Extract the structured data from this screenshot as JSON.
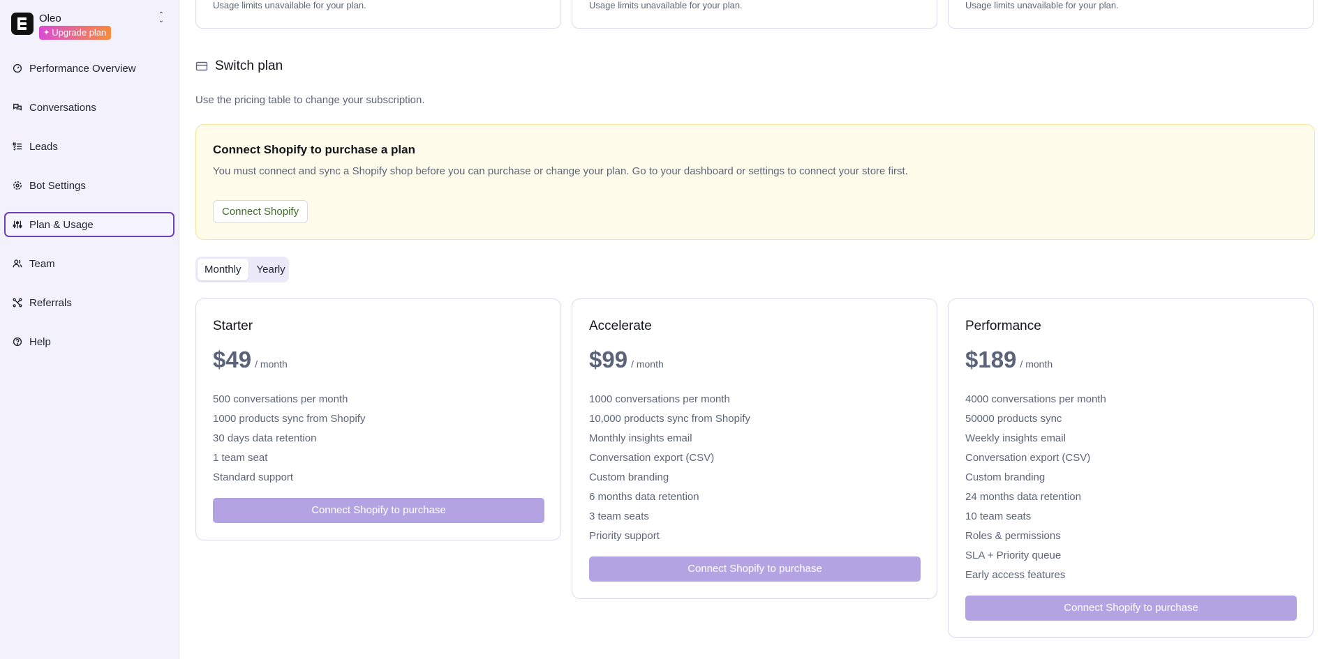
{
  "sidebar": {
    "workspace_name": "Oleo",
    "upgrade_label": "Upgrade plan",
    "items": [
      {
        "label": "Performance Overview",
        "icon": "gauge-icon"
      },
      {
        "label": "Conversations",
        "icon": "chat-icon"
      },
      {
        "label": "Leads",
        "icon": "list-check-icon"
      },
      {
        "label": "Bot Settings",
        "icon": "gear-icon"
      },
      {
        "label": "Plan & Usage",
        "icon": "sliders-icon",
        "active": true
      },
      {
        "label": "Team",
        "icon": "users-icon"
      },
      {
        "label": "Referrals",
        "icon": "network-icon"
      },
      {
        "label": "Help",
        "icon": "help-circle-icon"
      }
    ]
  },
  "usage": {
    "cards": [
      {
        "text": "Usage limits unavailable for your plan."
      },
      {
        "text": "Usage limits unavailable for your plan."
      },
      {
        "text": "Usage limits unavailable for your plan."
      }
    ]
  },
  "switch_plan": {
    "title": "Switch plan",
    "subtitle": "Use the pricing table to change your subscription.",
    "icon": "credit-card-icon"
  },
  "alert": {
    "title": "Connect Shopify to purchase a plan",
    "text": "You must connect and sync a Shopify shop before you can purchase or change your plan. Go to your dashboard or settings to connect your store first.",
    "button_label": "Connect Shopify"
  },
  "billing_toggle": {
    "options": [
      "Monthly",
      "Yearly"
    ],
    "selected": "Monthly"
  },
  "plans": [
    {
      "name": "Starter",
      "price": "$49",
      "unit": "/ month",
      "features": [
        "500 conversations per month",
        "1000 products sync from Shopify",
        "30 days data retention",
        "1 team seat",
        "Standard support"
      ],
      "button_label": "Connect Shopify to purchase"
    },
    {
      "name": "Accelerate",
      "price": "$99",
      "unit": "/ month",
      "features": [
        "1000 conversations per month",
        "10,000 products sync from Shopify",
        "Monthly insights email",
        "Conversation export (CSV)",
        "Custom branding",
        "6 months data retention",
        "3 team seats",
        "Priority support"
      ],
      "button_label": "Connect Shopify to purchase"
    },
    {
      "name": "Performance",
      "price": "$189",
      "unit": "/ month",
      "features": [
        "4000 conversations per month",
        "50000 products sync",
        "Weekly insights email",
        "Conversation export (CSV)",
        "Custom branding",
        "24 months data retention",
        "10 team seats",
        "Roles & permissions",
        "SLA + Priority queue",
        "Early access features"
      ],
      "button_label": "Connect Shopify to purchase"
    }
  ],
  "colors": {
    "accent": "#6b3fb8",
    "button_disabled": "#b3a3e3",
    "sidebar_bg": "#f3f1fc",
    "alert_bg": "#fffceb"
  }
}
